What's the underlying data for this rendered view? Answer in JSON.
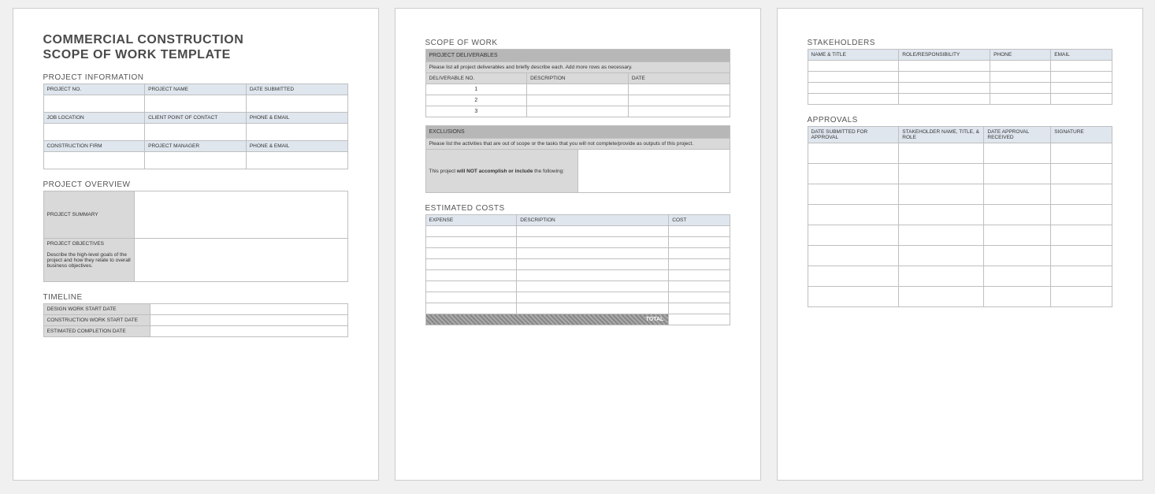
{
  "title_line1": "COMMERCIAL CONSTRUCTION",
  "title_line2": "SCOPE OF WORK TEMPLATE",
  "page1": {
    "projectInfo": {
      "heading": "PROJECT INFORMATION",
      "row1": {
        "a": "PROJECT NO.",
        "b": "PROJECT NAME",
        "c": "DATE SUBMITTED"
      },
      "row2": {
        "a": "JOB LOCATION",
        "b": "CLIENT POINT OF CONTACT",
        "c": "PHONE & EMAIL"
      },
      "row3": {
        "a": "CONSTRUCTION FIRM",
        "b": "PROJECT MANAGER",
        "c": "PHONE & EMAIL"
      }
    },
    "overview": {
      "heading": "PROJECT OVERVIEW",
      "summary": "PROJECT SUMMARY",
      "objectives": "PROJECT OBJECTIVES",
      "objectives_desc": "Describe the high-level goals of the project and how they relate to overall business objectives."
    },
    "timeline": {
      "heading": "TIMELINE",
      "r1": "DESIGN WORK START DATE",
      "r2": "CONSTRUCTION WORK START DATE",
      "r3": "ESTIMATED COMPLETION DATE"
    }
  },
  "page2": {
    "scope": {
      "heading": "SCOPE OF WORK",
      "deliv_band": "PROJECT DELIVERABLES",
      "deliv_desc": "Please list all project deliverables and briefly describe each. Add more rows as necessary.",
      "deliv_h1": "DELIVERABLE NO.",
      "deliv_h2": "DESCRIPTION",
      "deliv_h3": "DATE",
      "d1": "1",
      "d2": "2",
      "d3": "3",
      "excl_band": "EXCLUSIONS",
      "excl_desc": "Please list the activities that are out of scope or the tasks that you will not complete/provide as outputs of this project.",
      "excl_note1": "This project ",
      "excl_note2": "will NOT accomplish or include",
      "excl_note3": " the following:"
    },
    "costs": {
      "heading": "ESTIMATED COSTS",
      "h1": "EXPENSE",
      "h2": "DESCRIPTION",
      "h3": "COST",
      "total": "TOTAL"
    }
  },
  "page3": {
    "stakeholders": {
      "heading": "STAKEHOLDERS",
      "h1": "NAME & TITLE",
      "h2": "ROLE/RESPONSIBILITY",
      "h3": "PHONE",
      "h4": "EMAIL"
    },
    "approvals": {
      "heading": "APPROVALS",
      "h1": "DATE SUBMITTED FOR APPROVAL",
      "h2": "STAKEHOLDER NAME, TITLE, & ROLE",
      "h3": "DATE APPROVAL RECEIVED",
      "h4": "SIGNATURE"
    }
  }
}
